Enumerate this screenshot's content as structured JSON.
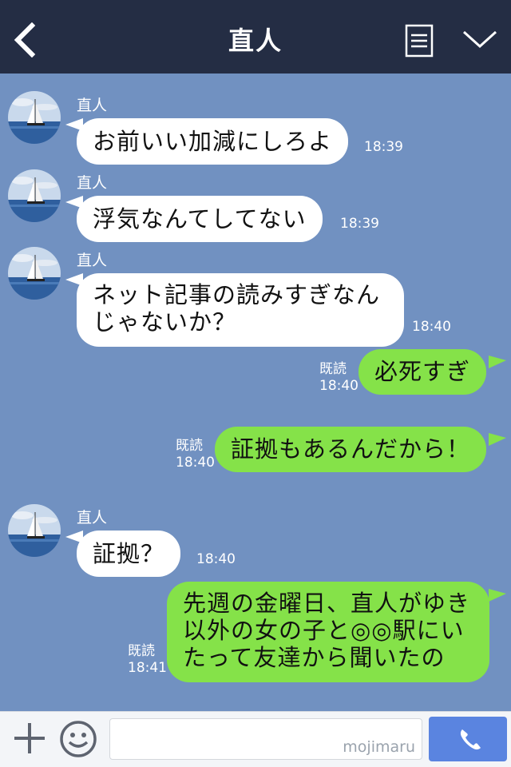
{
  "header": {
    "title": "直人",
    "back_icon": "chevron-left-icon",
    "menu_icon": "menu-list-icon",
    "collapse_icon": "chevron-down-icon"
  },
  "colors": {
    "header_bg": "#242d44",
    "chat_bg": "#7191c1",
    "incoming_bubble": "#ffffff",
    "outgoing_bubble": "#85e249",
    "send_button": "#5a84e0"
  },
  "messages": [
    {
      "sender": "直人",
      "text": [
        "お前いい加減にしろよ"
      ],
      "time": "18:39"
    },
    {
      "sender": "直人",
      "text": [
        "浮気なんてしてない"
      ],
      "time": "18:39"
    },
    {
      "sender": "直人",
      "text": [
        "ネット記事の読みすぎなん",
        "じゃないか？"
      ],
      "time": "18:40"
    },
    {
      "read": "既読",
      "text": [
        "必死すぎ"
      ],
      "time": "18:40"
    },
    {
      "read": "既読",
      "text": [
        "証拠もあるんだから！"
      ],
      "time": "18:40"
    },
    {
      "sender": "直人",
      "text": [
        "証拠？"
      ],
      "time": "18:40"
    },
    {
      "read": "既読",
      "text": [
        "先週の金曜日、直人がゆき",
        "以外の女の子と◎◎駅にい",
        "たって友達から聞いたの"
      ],
      "time": "18:41"
    }
  ],
  "footer": {
    "plus_icon": "plus-icon",
    "sticker_icon": "smiley-icon",
    "input_value": "",
    "watermark": "mojimaru",
    "call_icon": "phone-icon"
  }
}
